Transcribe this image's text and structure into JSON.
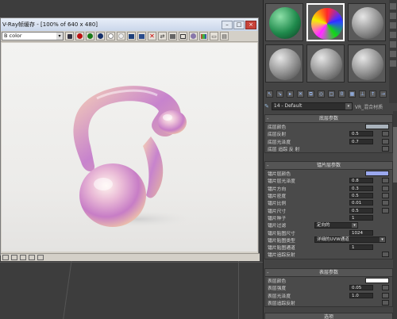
{
  "vfb": {
    "title": "V-Ray帧缓存 - [100% of 640 x 480]",
    "channel": "B color",
    "status_text": "",
    "buttons": [
      "red-channel",
      "green-channel",
      "blue-channel",
      "alpha",
      "mono",
      "save",
      "clear",
      "track",
      "compare-a",
      "compare-b",
      "region",
      "lens",
      "print"
    ]
  },
  "material_editor": {
    "material_name": "14 - Default",
    "material_type": "VR_混合材质",
    "rollouts": [
      {
        "title": "底层参数",
        "rows": [
          {
            "label": "底层颜色",
            "kind": "swatch",
            "color": "#a9b2bb"
          },
          {
            "label": "底层反射",
            "kind": "spin",
            "value": "0.5"
          },
          {
            "label": "底层光泽度",
            "kind": "spin",
            "value": "0.7"
          },
          {
            "label": "底层 追踪 反 射",
            "kind": "check"
          }
        ]
      },
      {
        "title": "镭片层参数",
        "rows": [
          {
            "label": "镭片层颜色",
            "kind": "swatch",
            "color": "#9aa8ee"
          },
          {
            "label": "镭片层光泽度",
            "kind": "spin",
            "value": "0.8"
          },
          {
            "label": "镭片方向",
            "kind": "spin",
            "value": "0.3"
          },
          {
            "label": "镭片密度",
            "kind": "spin",
            "value": "0.5"
          },
          {
            "label": "镭片比例",
            "kind": "spin",
            "value": "0.01"
          },
          {
            "label": "镭片尺寸",
            "kind": "spin",
            "value": "0.5"
          },
          {
            "label": "镭片种子",
            "kind": "spin",
            "value": "1"
          },
          {
            "label": "镭片过滤",
            "kind": "drop",
            "value": "定向的"
          },
          {
            "label": "镭片贴图尺寸",
            "kind": "spin",
            "value": "1024"
          },
          {
            "label": "镭片贴图类型",
            "kind": "drop",
            "value": "详细的UVW通道"
          },
          {
            "label": "镭片贴图通道",
            "kind": "spin",
            "value": "1"
          },
          {
            "label": "镭片追踪反射",
            "kind": "check"
          }
        ]
      },
      {
        "title": "表层参数",
        "rows": [
          {
            "label": "表层颜色",
            "kind": "swatch",
            "color": "#ffffff"
          },
          {
            "label": "表层强度",
            "kind": "spin",
            "value": "0.05"
          },
          {
            "label": "表层光泽度",
            "kind": "spin",
            "value": "1.0"
          },
          {
            "label": "表层追踪反射",
            "kind": "check"
          }
        ]
      }
    ],
    "footer_label": "选项"
  }
}
